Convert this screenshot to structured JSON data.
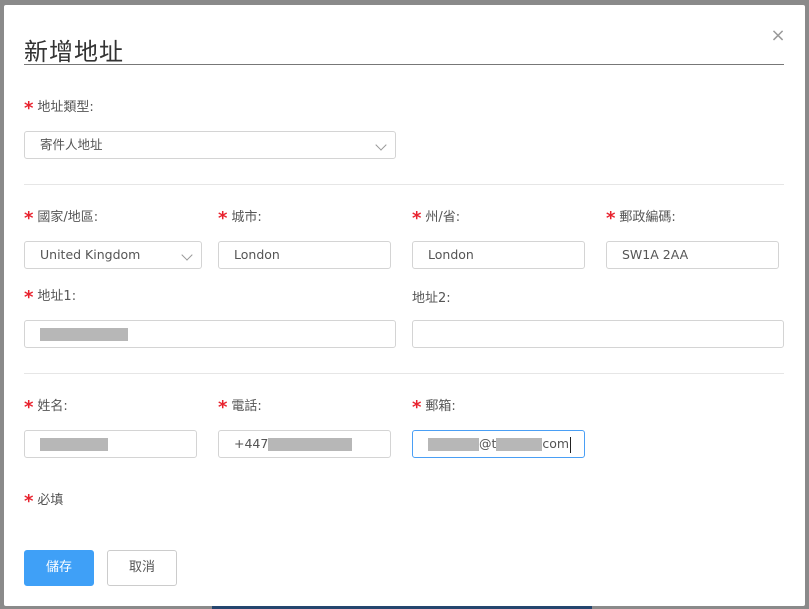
{
  "dialog": {
    "title": "新增地址",
    "close_glyph": "×",
    "required_note": "必填",
    "required_mark": "*"
  },
  "address_type": {
    "label": "地址類型:",
    "value": "寄件人地址"
  },
  "country": {
    "label": "國家/地區:",
    "value": "United Kingdom"
  },
  "city": {
    "label": "城市:",
    "value": "London"
  },
  "state": {
    "label": "州/省:",
    "value": "London"
  },
  "postcode": {
    "label": "郵政編碼:",
    "value": "SW1A 2AA"
  },
  "address1": {
    "label": "地址1:",
    "value": ""
  },
  "address2": {
    "label": "地址2:",
    "value": ""
  },
  "name": {
    "label": "姓名:",
    "value": ""
  },
  "phone": {
    "label": "電話:",
    "prefix": "+447"
  },
  "email": {
    "label": "郵箱:",
    "at_part": "@t",
    "suffix": "com"
  },
  "buttons": {
    "save": "儲存",
    "cancel": "取消"
  },
  "colors": {
    "primary": "#3fa0f7",
    "required": "#e8222e",
    "focus_border": "#4a9ff5"
  }
}
